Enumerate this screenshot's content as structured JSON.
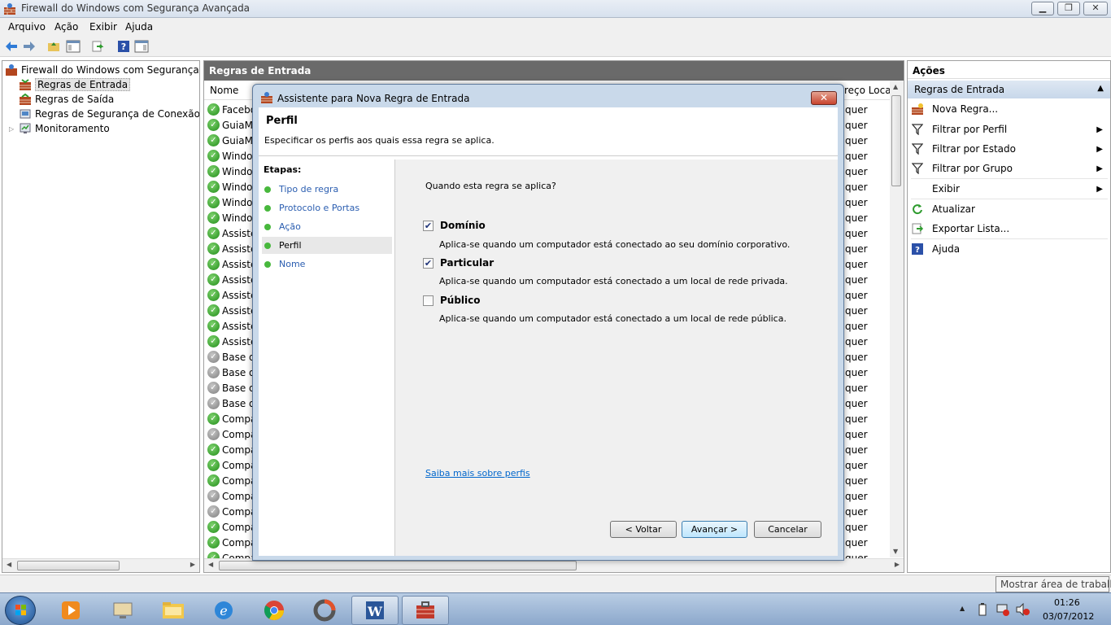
{
  "window": {
    "title": "Firewall do Windows com Segurança Avançada",
    "min_glyph": "▁",
    "max_glyph": "❐",
    "close_glyph": "✕"
  },
  "menu": [
    "Arquivo",
    "Ação",
    "Exibir",
    "Ajuda"
  ],
  "tree": {
    "root": "Firewall do Windows com Segurança Ava",
    "items": [
      "Regras de Entrada",
      "Regras de Saída",
      "Regras de Segurança de Conexão",
      "Monitoramento"
    ],
    "expand_glyph": "▷"
  },
  "center": {
    "header": "Regras de Entrada",
    "col_name": "Nome",
    "col_local": "reço Local",
    "rows": [
      {
        "name": "Facebo",
        "enabled": true,
        "local": "quer"
      },
      {
        "name": "GuiaMi",
        "enabled": true,
        "local": "quer"
      },
      {
        "name": "GuiaMi",
        "enabled": true,
        "local": "quer"
      },
      {
        "name": "Window",
        "enabled": true,
        "local": "quer"
      },
      {
        "name": "Window",
        "enabled": true,
        "local": "quer"
      },
      {
        "name": "Window",
        "enabled": true,
        "local": "quer"
      },
      {
        "name": "Window",
        "enabled": true,
        "local": "quer"
      },
      {
        "name": "Window",
        "enabled": true,
        "local": "quer"
      },
      {
        "name": "Assistê",
        "enabled": true,
        "local": "quer"
      },
      {
        "name": "Assistê",
        "enabled": true,
        "local": "quer"
      },
      {
        "name": "Assistê",
        "enabled": true,
        "local": "quer"
      },
      {
        "name": "Assistê",
        "enabled": true,
        "local": "quer"
      },
      {
        "name": "Assistê",
        "enabled": true,
        "local": "quer"
      },
      {
        "name": "Assistê",
        "enabled": true,
        "local": "quer"
      },
      {
        "name": "Assistê",
        "enabled": true,
        "local": "quer"
      },
      {
        "name": "Assistê",
        "enabled": true,
        "local": "quer"
      },
      {
        "name": "Base da",
        "enabled": false,
        "local": "quer"
      },
      {
        "name": "Base da",
        "enabled": false,
        "local": "quer"
      },
      {
        "name": "Base da",
        "enabled": false,
        "local": "quer"
      },
      {
        "name": "Base da",
        "enabled": false,
        "local": "quer"
      },
      {
        "name": "Compa",
        "enabled": true,
        "local": "quer"
      },
      {
        "name": "Compa",
        "enabled": false,
        "local": "quer"
      },
      {
        "name": "Compa",
        "enabled": true,
        "local": "quer"
      },
      {
        "name": "Compa",
        "enabled": true,
        "local": "quer"
      },
      {
        "name": "Compa",
        "enabled": true,
        "local": "quer"
      },
      {
        "name": "Compa",
        "enabled": false,
        "local": "quer"
      },
      {
        "name": "Compa",
        "enabled": false,
        "local": "quer"
      },
      {
        "name": "Compa",
        "enabled": true,
        "local": "quer"
      },
      {
        "name": "Compa",
        "enabled": true,
        "local": "quer"
      },
      {
        "name": "Compa",
        "enabled": true,
        "local": "quer"
      }
    ]
  },
  "actions": {
    "title": "Ações",
    "section": "Regras de Entrada",
    "items": [
      {
        "label": "Nova Regra...",
        "icon": "new-rule-icon",
        "submenu": false
      },
      {
        "label": "Filtrar por Perfil",
        "icon": "filter-icon",
        "submenu": true
      },
      {
        "label": "Filtrar por Estado",
        "icon": "filter-icon",
        "submenu": true
      },
      {
        "label": "Filtrar por Grupo",
        "icon": "filter-icon",
        "submenu": true
      },
      {
        "label": "Exibir",
        "icon": "",
        "submenu": true
      },
      {
        "label": "Atualizar",
        "icon": "refresh-icon",
        "submenu": false
      },
      {
        "label": "Exportar Lista...",
        "icon": "export-icon",
        "submenu": false
      },
      {
        "label": "Ajuda",
        "icon": "help-icon",
        "submenu": false
      }
    ]
  },
  "wizard": {
    "title": "Assistente para Nova Regra de Entrada",
    "close_glyph": "✕",
    "heading": "Perfil",
    "subheading": "Especificar os perfis aos quais essa regra se aplica.",
    "steps_title": "Etapas:",
    "steps": [
      "Tipo de regra",
      "Protocolo e Portas",
      "Ação",
      "Perfil",
      "Nome"
    ],
    "current_step": 3,
    "question": "Quando esta regra se aplica?",
    "options": [
      {
        "label": "Domínio",
        "checked": true,
        "desc": "Aplica-se quando um computador está conectado ao seu domínio corporativo."
      },
      {
        "label": "Particular",
        "checked": true,
        "desc": "Aplica-se quando um computador está conectado a um local de rede privada."
      },
      {
        "label": "Público",
        "checked": false,
        "desc": "Aplica-se quando um computador está conectado a um local de rede pública."
      }
    ],
    "learn_more": "Saiba mais sobre perfis",
    "buttons": {
      "back": "< Voltar",
      "next": "Avançar >",
      "cancel": "Cancelar"
    }
  },
  "tooltip": "Mostrar área de trabalho",
  "taskbar": {
    "apps": [
      "media-player-icon",
      "monitor-icon",
      "explorer-icon",
      "ie-icon",
      "chrome-icon",
      "app-icon",
      "word-icon",
      "firewall-icon"
    ],
    "time": "01:26",
    "date": "03/07/2012"
  },
  "colors": {
    "accent": "#2a5db0",
    "enabled": "#1f8c17",
    "disabled": "#7d7d7d"
  }
}
